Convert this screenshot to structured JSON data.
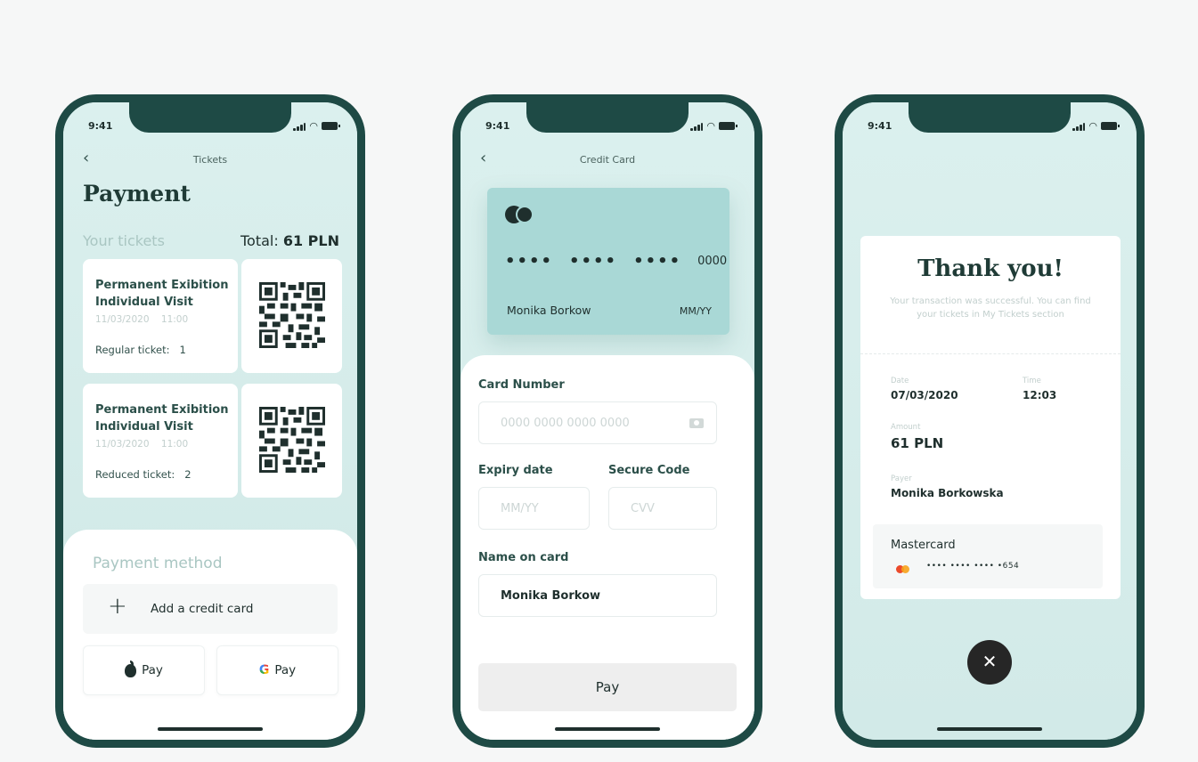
{
  "status": {
    "time": "9:41"
  },
  "screen1": {
    "nav_title": "Tickets",
    "page_title": "Payment",
    "your_tickets_label": "Your tickets",
    "total_prefix": "Total: ",
    "total_value": "61 PLN",
    "tickets": [
      {
        "name": "Permanent Exibition Individual Visit",
        "date": "11/03/2020",
        "time": "11:00",
        "type_label": "Regular ticket:",
        "quantity": "1"
      },
      {
        "name": "Permanent Exibition Individual Visit",
        "date": "11/03/2020",
        "time": "11:00",
        "type_label": "Reduced ticket:",
        "quantity": "2"
      }
    ],
    "payment_method_label": "Payment method",
    "add_card_label": "Add a credit card",
    "apple_pay_label": "Pay",
    "google_pay_label": "Pay",
    "google_g": "G"
  },
  "screen2": {
    "nav_title": "Credit Card",
    "card": {
      "masked_group": "••••",
      "last4": "0000",
      "holder": "Monika Borkow",
      "expiry": "MM/YY"
    },
    "card_number_label": "Card Number",
    "card_number_placeholder": "0000 0000 0000 0000",
    "expiry_label": "Expiry date",
    "expiry_placeholder": "MM/YY",
    "secure_label": "Secure Code",
    "secure_placeholder": "CVV",
    "name_label": "Name on card",
    "name_value": "Monika Borkow",
    "pay_label": "Pay"
  },
  "screen3": {
    "title": "Thank you!",
    "message": "Your transaction was successful. You can find your tickets in My Tickets section",
    "date_label": "Date",
    "date_value": "07/03/2020",
    "time_label": "Time",
    "time_value": "12:03",
    "amount_label": "Amount",
    "amount_value": "61 PLN",
    "payer_label": "Payer",
    "payer_value": "Monika Borkowska",
    "method_name": "Mastercard",
    "masked_number": "•••• •••• •••• •654",
    "close_glyph": "✕"
  },
  "icons": {
    "back": "chevron-left-icon",
    "signal": "signal-icon",
    "wifi": "wifi-icon",
    "battery": "battery-icon",
    "qr": "qr-code-icon",
    "plus": "plus-icon",
    "apple": "apple-icon",
    "google": "google-icon",
    "mastercard": "mastercard-icon",
    "camera": "camera-icon",
    "close": "close-icon"
  },
  "colors": {
    "frame": "#1e4a45",
    "accent_card": "#a9d8d6",
    "background": "#d9efed",
    "text_dark": "#1f3b36"
  }
}
